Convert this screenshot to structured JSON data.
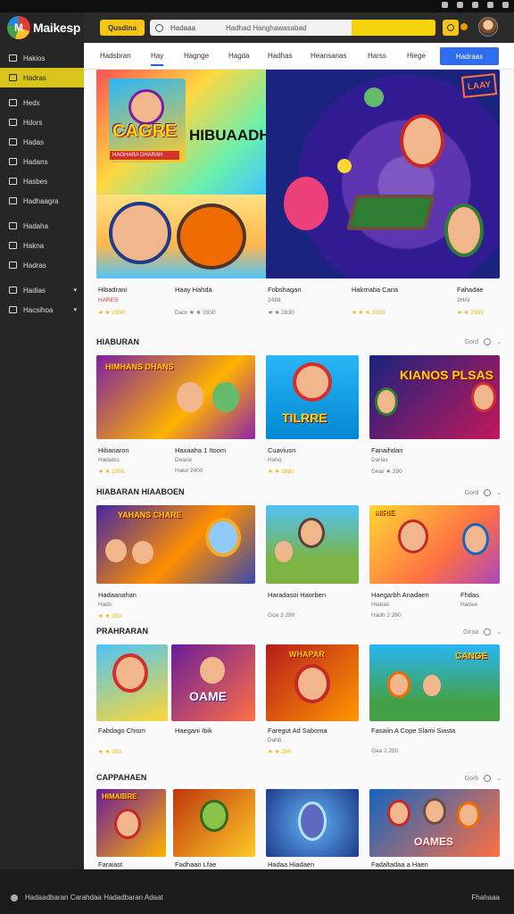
{
  "app": {
    "brand": "Maikesp"
  },
  "sidebar": {
    "items": [
      {
        "label": "Hakios"
      },
      {
        "label": "Hadras"
      },
      {
        "label": "Hedx"
      },
      {
        "label": "Hdors"
      },
      {
        "label": "Hadas"
      },
      {
        "label": "Hadans"
      },
      {
        "label": "Hasbes"
      },
      {
        "label": "Hadhaagra"
      },
      {
        "label": "Hadaha"
      },
      {
        "label": "Hakna"
      },
      {
        "label": "Hadras"
      },
      {
        "label": "Hadias"
      },
      {
        "label": "Hacsihoa"
      }
    ]
  },
  "header": {
    "brand_button": "Qusdina",
    "search_label": "Hadaaa",
    "search_placeholder": "Hadhad Hanghawasabad"
  },
  "tabs": {
    "items": [
      "Hadsbran",
      "Hay",
      "Hagnge",
      "Hagda",
      "Hadhas",
      "Heansanas",
      "Harss",
      "Hiege"
    ],
    "cta": "Hadraas"
  },
  "hero": {
    "title_a": "CAGRE",
    "title_b": "HIBUAADH",
    "strip": "HAGHARA DHARAN",
    "tag": "LAAY"
  },
  "row1": [
    {
      "title": "Hibadrani",
      "meta": "HARES",
      "sub": "★ ★ 2300"
    },
    {
      "title": "Haay Hahda",
      "meta": "",
      "sub": "Daor ★ ★ 2830"
    },
    {
      "title": "Fobshagan",
      "meta": "2498",
      "sub": "★ ★ 2830"
    },
    {
      "title": "Hakmaba Caria",
      "meta": "",
      "sub": "★ ★ ★ 2330"
    },
    {
      "title": "Fahadae",
      "meta": "2HAI",
      "sub": "★ ★ 2303"
    }
  ],
  "sections": [
    {
      "title": "HIABURAN",
      "ctrl": "Gord",
      "tiles_text": [
        "HIMHANS DHANS",
        "TILRRE",
        "KIANOS PLSAS"
      ],
      "items": [
        {
          "title": "Hibanaron",
          "meta": "Hadabis",
          "sub": "★ ★ 2305"
        },
        {
          "title": "Haxaaha 1 Itoom",
          "meta": "Doarie",
          "sub": "Hake 2400"
        },
        {
          "title": "Cuaviusn",
          "meta": "Haho",
          "sub": "★ ★ 2880"
        },
        {
          "title": "Fanaihdan",
          "meta": "Darlas",
          "sub": "Gear ★ 280"
        }
      ]
    },
    {
      "title": "HIABARAN HIAABOEN",
      "ctrl": "Gord",
      "tiles_text": [
        "YAHANS CHARE",
        "",
        "MIRIE"
      ],
      "items": [
        {
          "title": "Hadaanahan",
          "meta": "Hadx",
          "sub": "★ ★ 280"
        },
        {
          "title": "Haradasoi Haorben",
          "meta": "",
          "sub": "Goa 3 280"
        },
        {
          "title": "Haegarbh Anadaen",
          "meta": "Hiabas",
          "sub": "Hadh 2 280"
        },
        {
          "title": "Fhdas",
          "meta": "Hadae",
          "sub": ""
        }
      ]
    },
    {
      "title": "PRAHRARAN",
      "ctrl": "Giraa",
      "tiles_text": [
        "",
        "OAME",
        "WHAPAR",
        "CANGE"
      ],
      "items": [
        {
          "title": "Fabdago Chism",
          "meta": "",
          "sub": "★ ★ 280"
        },
        {
          "title": "Haegani Ibik",
          "meta": "",
          "sub": ""
        },
        {
          "title": "Faregut Ad Saboma",
          "meta": "Dahb",
          "sub": "★ ★ 280"
        },
        {
          "title": "Fasaiin A Cope Slami Siasta",
          "meta": "",
          "sub": "Gaa 2 280"
        }
      ]
    },
    {
      "title": "CAPPAHAEN",
      "ctrl": "Gorb",
      "tiles_text": [
        "HIMAIBRE",
        "",
        "",
        "OAMES"
      ],
      "items": [
        {
          "title": "Faraiast",
          "meta": "",
          "sub": ""
        },
        {
          "title": "Fadhaan Lfae",
          "meta": "",
          "sub": ""
        },
        {
          "title": "Hadaa Hiadaen",
          "meta": "",
          "sub": ""
        },
        {
          "title": "Fadaltadaa a Haen",
          "meta": "",
          "sub": ""
        }
      ]
    }
  ],
  "footer": {
    "left": "Hadaadbaran Carahdaa Hadadbaran Adaat",
    "right": "Fhahaaa"
  }
}
